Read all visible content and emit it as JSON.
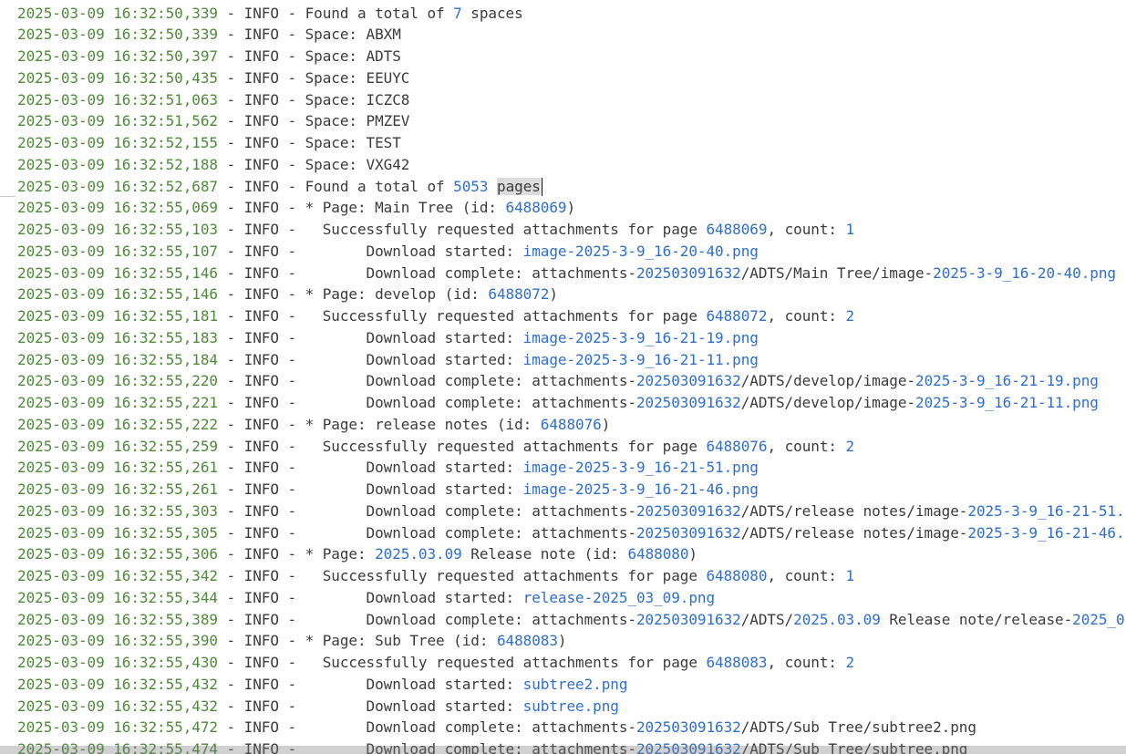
{
  "colors": {
    "timestamp": "#4e8a3a",
    "number": "#2f6fc9",
    "text": "#3b3b3b",
    "highlight": "#dcdcdc"
  },
  "cursor_line_index": 8,
  "lines": [
    [
      {
        "t": "2025-03-09 16:32:50,339",
        "c": "ts"
      },
      {
        "t": " - INFO - Found a total of "
      },
      {
        "t": "7",
        "c": "num"
      },
      {
        "t": " spaces"
      }
    ],
    [
      {
        "t": "2025-03-09 16:32:50,339",
        "c": "ts"
      },
      {
        "t": " - INFO - Space: ABXM"
      }
    ],
    [
      {
        "t": "2025-03-09 16:32:50,397",
        "c": "ts"
      },
      {
        "t": " - INFO - Space: ADTS"
      }
    ],
    [
      {
        "t": "2025-03-09 16:32:50,435",
        "c": "ts"
      },
      {
        "t": " - INFO - Space: EEUYC"
      }
    ],
    [
      {
        "t": "2025-03-09 16:32:51,063",
        "c": "ts"
      },
      {
        "t": " - INFO - Space: ICZC8"
      }
    ],
    [
      {
        "t": "2025-03-09 16:32:51,562",
        "c": "ts"
      },
      {
        "t": " - INFO - Space: PMZEV"
      }
    ],
    [
      {
        "t": "2025-03-09 16:32:52,155",
        "c": "ts"
      },
      {
        "t": " - INFO - Space: TEST"
      }
    ],
    [
      {
        "t": "2025-03-09 16:32:52,188",
        "c": "ts"
      },
      {
        "t": " - INFO - Space: VXG42"
      }
    ],
    [
      {
        "t": "2025-03-09 16:32:52,687",
        "c": "ts"
      },
      {
        "t": " - INFO - Found a total of "
      },
      {
        "t": "5053",
        "c": "num"
      },
      {
        "t": " "
      },
      {
        "t": "pages",
        "c": "hl"
      },
      {
        "caret": true
      }
    ],
    [
      {
        "t": "2025-03-09 16:32:55,069",
        "c": "ts"
      },
      {
        "t": " - INFO - * Page: Main Tree (id: "
      },
      {
        "t": "6488069",
        "c": "num"
      },
      {
        "t": ")"
      }
    ],
    [
      {
        "t": "2025-03-09 16:32:55,103",
        "c": "ts"
      },
      {
        "t": " - INFO -   Successfully requested attachments for page "
      },
      {
        "t": "6488069",
        "c": "num"
      },
      {
        "t": ", count: "
      },
      {
        "t": "1",
        "c": "num"
      }
    ],
    [
      {
        "t": "2025-03-09 16:32:55,107",
        "c": "ts"
      },
      {
        "t": " - INFO -        Download started: "
      },
      {
        "t": "image-2025-3-9_16-20-40.png",
        "c": "link"
      }
    ],
    [
      {
        "t": "2025-03-09 16:32:55,146",
        "c": "ts"
      },
      {
        "t": " - INFO -        Download complete: attachments-"
      },
      {
        "t": "202503091632",
        "c": "num"
      },
      {
        "t": "/ADTS/Main Tree/image-"
      },
      {
        "t": "2025-3-9_16-20-40.png",
        "c": "link"
      }
    ],
    [
      {
        "t": "2025-03-09 16:32:55,146",
        "c": "ts"
      },
      {
        "t": " - INFO - * Page: develop (id: "
      },
      {
        "t": "6488072",
        "c": "num"
      },
      {
        "t": ")"
      }
    ],
    [
      {
        "t": "2025-03-09 16:32:55,181",
        "c": "ts"
      },
      {
        "t": " - INFO -   Successfully requested attachments for page "
      },
      {
        "t": "6488072",
        "c": "num"
      },
      {
        "t": ", count: "
      },
      {
        "t": "2",
        "c": "num"
      }
    ],
    [
      {
        "t": "2025-03-09 16:32:55,183",
        "c": "ts"
      },
      {
        "t": " - INFO -        Download started: "
      },
      {
        "t": "image-2025-3-9_16-21-19.png",
        "c": "link"
      }
    ],
    [
      {
        "t": "2025-03-09 16:32:55,184",
        "c": "ts"
      },
      {
        "t": " - INFO -        Download started: "
      },
      {
        "t": "image-2025-3-9_16-21-11.png",
        "c": "link"
      }
    ],
    [
      {
        "t": "2025-03-09 16:32:55,220",
        "c": "ts"
      },
      {
        "t": " - INFO -        Download complete: attachments-"
      },
      {
        "t": "202503091632",
        "c": "num"
      },
      {
        "t": "/ADTS/develop/image-"
      },
      {
        "t": "2025-3-9_16-21-19.png",
        "c": "link"
      }
    ],
    [
      {
        "t": "2025-03-09 16:32:55,221",
        "c": "ts"
      },
      {
        "t": " - INFO -        Download complete: attachments-"
      },
      {
        "t": "202503091632",
        "c": "num"
      },
      {
        "t": "/ADTS/develop/image-"
      },
      {
        "t": "2025-3-9_16-21-11.png",
        "c": "link"
      }
    ],
    [
      {
        "t": "2025-03-09 16:32:55,222",
        "c": "ts"
      },
      {
        "t": " - INFO - * Page: release notes (id: "
      },
      {
        "t": "6488076",
        "c": "num"
      },
      {
        "t": ")"
      }
    ],
    [
      {
        "t": "2025-03-09 16:32:55,259",
        "c": "ts"
      },
      {
        "t": " - INFO -   Successfully requested attachments for page "
      },
      {
        "t": "6488076",
        "c": "num"
      },
      {
        "t": ", count: "
      },
      {
        "t": "2",
        "c": "num"
      }
    ],
    [
      {
        "t": "2025-03-09 16:32:55,261",
        "c": "ts"
      },
      {
        "t": " - INFO -        Download started: "
      },
      {
        "t": "image-2025-3-9_16-21-51.png",
        "c": "link"
      }
    ],
    [
      {
        "t": "2025-03-09 16:32:55,261",
        "c": "ts"
      },
      {
        "t": " - INFO -        Download started: "
      },
      {
        "t": "image-2025-3-9_16-21-46.png",
        "c": "link"
      }
    ],
    [
      {
        "t": "2025-03-09 16:32:55,303",
        "c": "ts"
      },
      {
        "t": " - INFO -        Download complete: attachments-"
      },
      {
        "t": "202503091632",
        "c": "num"
      },
      {
        "t": "/ADTS/release notes/image-"
      },
      {
        "t": "2025-3-9_16-21-51.",
        "c": "link"
      }
    ],
    [
      {
        "t": "2025-03-09 16:32:55,305",
        "c": "ts"
      },
      {
        "t": " - INFO -        Download complete: attachments-"
      },
      {
        "t": "202503091632",
        "c": "num"
      },
      {
        "t": "/ADTS/release notes/image-"
      },
      {
        "t": "2025-3-9_16-21-46.",
        "c": "link"
      }
    ],
    [
      {
        "t": "2025-03-09 16:32:55,306",
        "c": "ts"
      },
      {
        "t": " - INFO - * Page: "
      },
      {
        "t": "2025.03.09",
        "c": "num"
      },
      {
        "t": " Release note (id: "
      },
      {
        "t": "6488080",
        "c": "num"
      },
      {
        "t": ")"
      }
    ],
    [
      {
        "t": "2025-03-09 16:32:55,342",
        "c": "ts"
      },
      {
        "t": " - INFO -   Successfully requested attachments for page "
      },
      {
        "t": "6488080",
        "c": "num"
      },
      {
        "t": ", count: "
      },
      {
        "t": "1",
        "c": "num"
      }
    ],
    [
      {
        "t": "2025-03-09 16:32:55,344",
        "c": "ts"
      },
      {
        "t": " - INFO -        Download started: "
      },
      {
        "t": "release-2025_03_09.png",
        "c": "link"
      }
    ],
    [
      {
        "t": "2025-03-09 16:32:55,389",
        "c": "ts"
      },
      {
        "t": " - INFO -        Download complete: attachments-"
      },
      {
        "t": "202503091632",
        "c": "num"
      },
      {
        "t": "/ADTS/"
      },
      {
        "t": "2025.03.09",
        "c": "num"
      },
      {
        "t": " Release note/release-"
      },
      {
        "t": "2025_0",
        "c": "link"
      }
    ],
    [
      {
        "t": "2025-03-09 16:32:55,390",
        "c": "ts"
      },
      {
        "t": " - INFO - * Page: Sub Tree (id: "
      },
      {
        "t": "6488083",
        "c": "num"
      },
      {
        "t": ")"
      }
    ],
    [
      {
        "t": "2025-03-09 16:32:55,430",
        "c": "ts"
      },
      {
        "t": " - INFO -   Successfully requested attachments for page "
      },
      {
        "t": "6488083",
        "c": "num"
      },
      {
        "t": ", count: "
      },
      {
        "t": "2",
        "c": "num"
      }
    ],
    [
      {
        "t": "2025-03-09 16:32:55,432",
        "c": "ts"
      },
      {
        "t": " - INFO -        Download started: "
      },
      {
        "t": "subtree2.png",
        "c": "link"
      }
    ],
    [
      {
        "t": "2025-03-09 16:32:55,432",
        "c": "ts"
      },
      {
        "t": " - INFO -        Download started: "
      },
      {
        "t": "subtree.png",
        "c": "link"
      }
    ],
    [
      {
        "t": "2025-03-09 16:32:55,472",
        "c": "ts"
      },
      {
        "t": " - INFO -        Download complete: attachments-"
      },
      {
        "t": "202503091632",
        "c": "num"
      },
      {
        "t": "/ADTS/Sub Tree/subtree2.png"
      }
    ],
    [
      {
        "t": "2025-03-09 16:32:55,474",
        "c": "ts"
      },
      {
        "t": " - INFO -        Download complete: attachments-"
      },
      {
        "t": "202503091632",
        "c": "num"
      },
      {
        "t": "/ADTS/Sub Tree/subtree.png"
      }
    ]
  ]
}
